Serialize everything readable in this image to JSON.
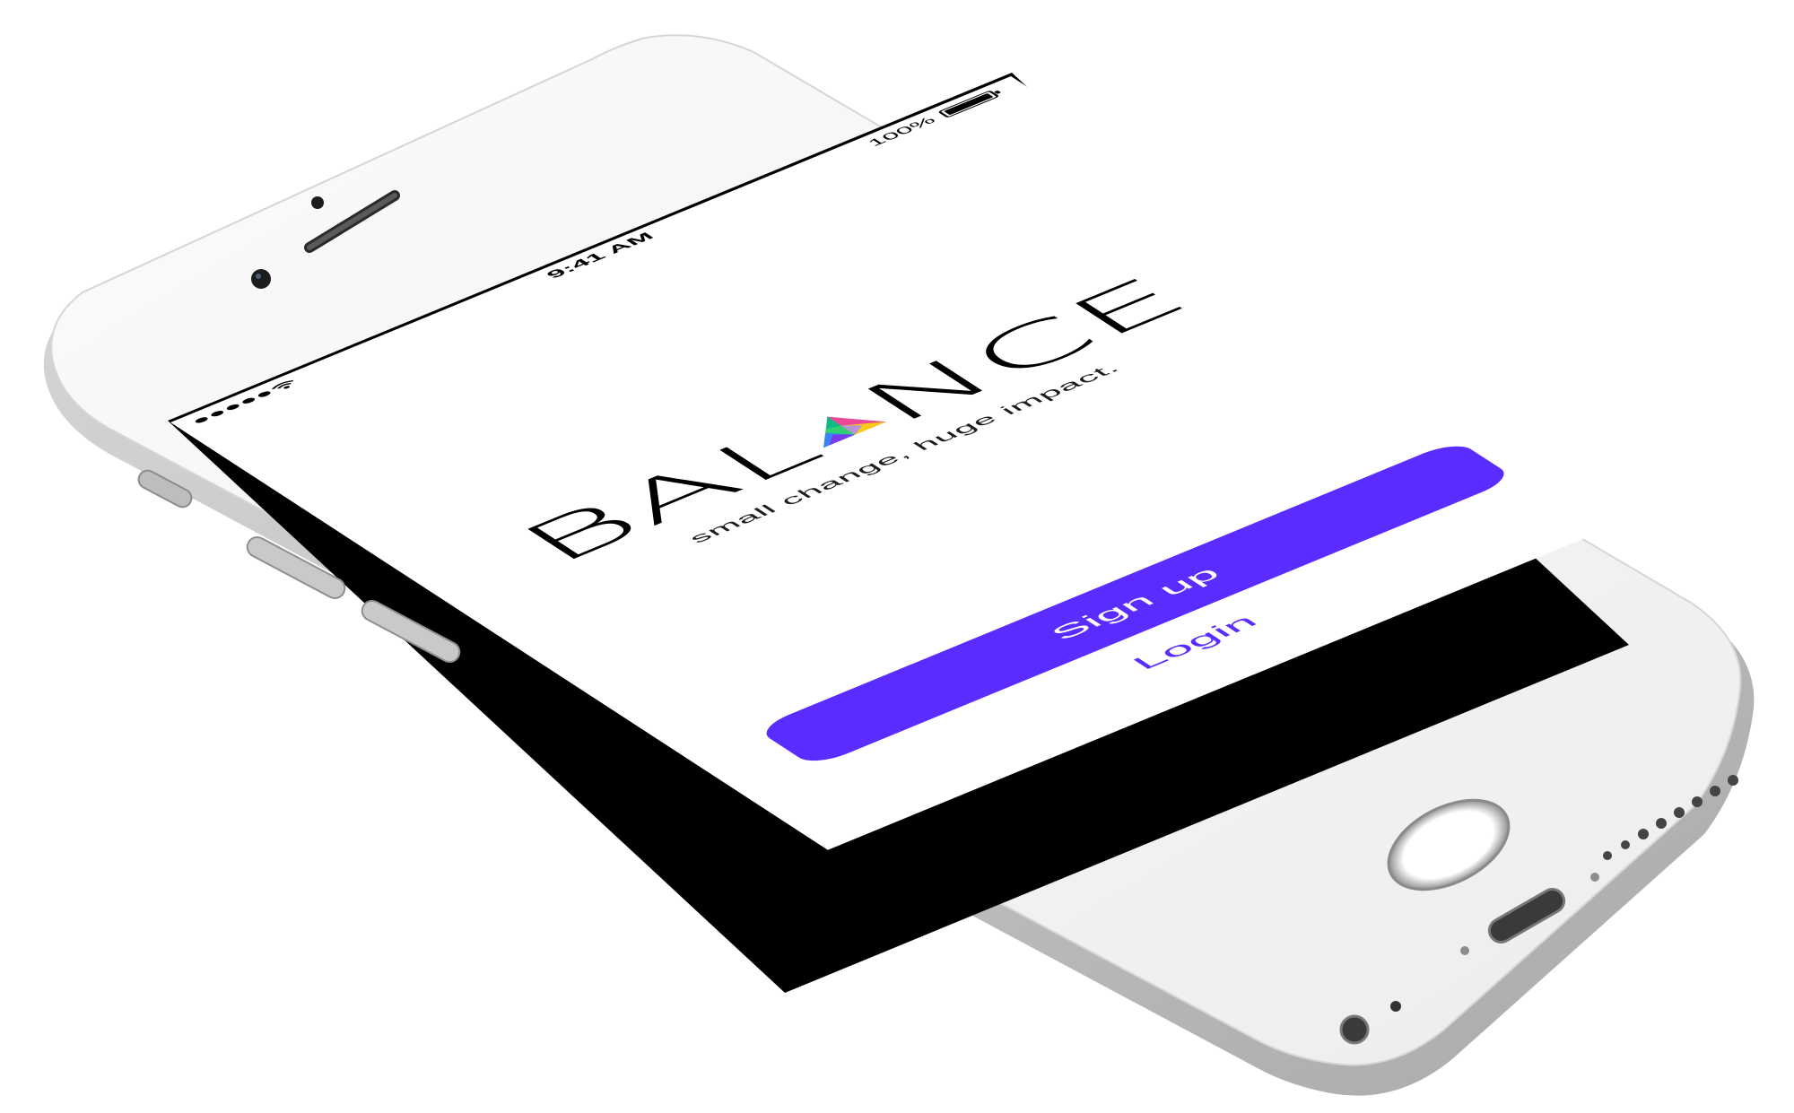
{
  "status_bar": {
    "time": "9:41 AM",
    "battery": "100%"
  },
  "brand": {
    "letters": [
      "B",
      "A",
      "L",
      "A",
      "N",
      "C",
      "E"
    ],
    "tagline": "small change, huge impact."
  },
  "actions": {
    "signup_label": "Sign up",
    "login_label": "Login"
  },
  "colors": {
    "accent": "#5b2cff",
    "prism": [
      "#2ecc71",
      "#3b82f6",
      "#ec4899",
      "#facc15",
      "#7c3aed",
      "#10b981"
    ]
  },
  "icons": {
    "signal": "signal-dots-icon",
    "wifi": "wifi-icon",
    "battery": "battery-icon",
    "prism": "prism-logo"
  }
}
